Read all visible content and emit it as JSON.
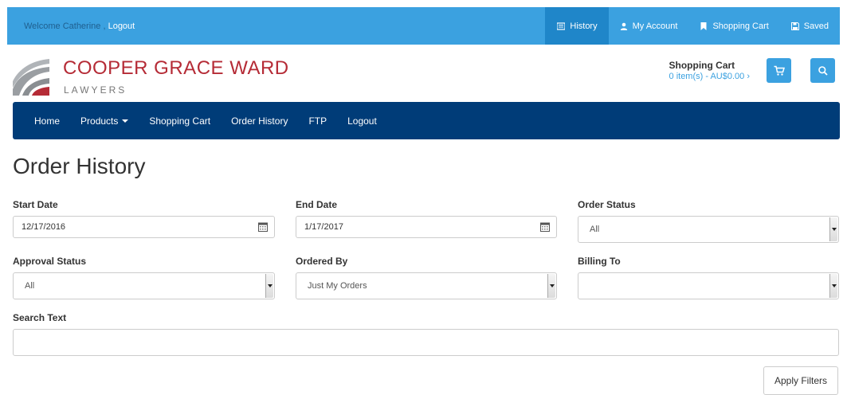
{
  "topbar": {
    "welcome_prefix": "Welcome Catherine ,",
    "logout_label": "Logout",
    "nav": [
      {
        "label": "History",
        "icon": "list-icon",
        "active": true
      },
      {
        "label": "My Account",
        "icon": "user-icon"
      },
      {
        "label": "Shopping Cart",
        "icon": "bookmark-icon"
      },
      {
        "label": "Saved",
        "icon": "save-icon"
      }
    ]
  },
  "header": {
    "logo_title": "COOPER GRACE WARD",
    "logo_subtitle": "LAWYERS",
    "cart_title": "Shopping Cart",
    "cart_summary": "0 item(s) - AU$0.00 ›",
    "cart_button_icon": "cart-icon",
    "search_button_icon": "search-icon"
  },
  "mainnav": {
    "items": [
      "Home",
      "Products",
      "Shopping Cart",
      "Order History",
      "FTP",
      "Logout"
    ]
  },
  "page": {
    "title": "Order History"
  },
  "filters": {
    "start_date": {
      "label": "Start Date",
      "value": "12/17/2016"
    },
    "end_date": {
      "label": "End Date",
      "value": "1/17/2017"
    },
    "order_status": {
      "label": "Order Status",
      "value": "All"
    },
    "approval_status": {
      "label": "Approval Status",
      "value": "All"
    },
    "ordered_by": {
      "label": "Ordered By",
      "value": "Just My Orders"
    },
    "billing_to": {
      "label": "Billing To",
      "value": ""
    },
    "search_text": {
      "label": "Search Text",
      "value": ""
    },
    "apply_label": "Apply Filters"
  },
  "colors": {
    "topbar": "#3ba1e0",
    "topbar_active": "#1f86c9",
    "mainnav": "#003c78",
    "brand_red": "#b52b36"
  }
}
